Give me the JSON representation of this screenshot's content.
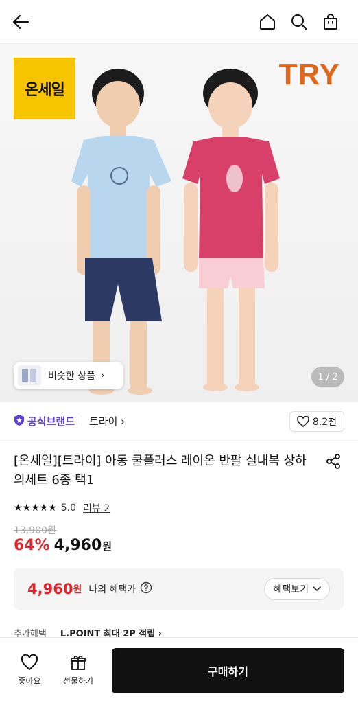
{
  "header": {
    "back_icon": "arrow-left-icon",
    "home_icon": "home-icon",
    "search_icon": "search-icon",
    "cart_icon": "shopping-bag-icon"
  },
  "hero": {
    "sale_logo_text": "온세일",
    "brand_logo_text": "TRY",
    "similar_label": "비슷한 상품",
    "similar_chevron": "›",
    "page_counter": "1 / 2"
  },
  "brand_row": {
    "official_label": "공식브랜드",
    "brand_name": "트라이 ›",
    "like_count": "8.2천"
  },
  "product": {
    "title": "[온세일][트라이] 아동 쿨플러스 레이온 반팔 실내복 상하의세트 6종 택1",
    "stars": "★★★★★",
    "rating": "5.0",
    "review_label": "리뷰 2",
    "original_price": "13,900원",
    "discount": "64%",
    "price": "4,960",
    "price_unit": "원"
  },
  "benefit": {
    "price": "4,960",
    "unit": "원",
    "label": "나의 혜택가",
    "button_label": "혜택보기"
  },
  "extra": {
    "label": "추가혜택",
    "text": "L.POINT 최대 2P 적립 ›"
  },
  "bottom": {
    "like_label": "좋아요",
    "gift_label": "선물하기",
    "buy_label": "구매하기"
  },
  "colors": {
    "accent_red": "#e0252b",
    "official_purple": "#5b3fd6",
    "brand_orange": "#e0661c",
    "sale_yellow": "#f7c500"
  }
}
